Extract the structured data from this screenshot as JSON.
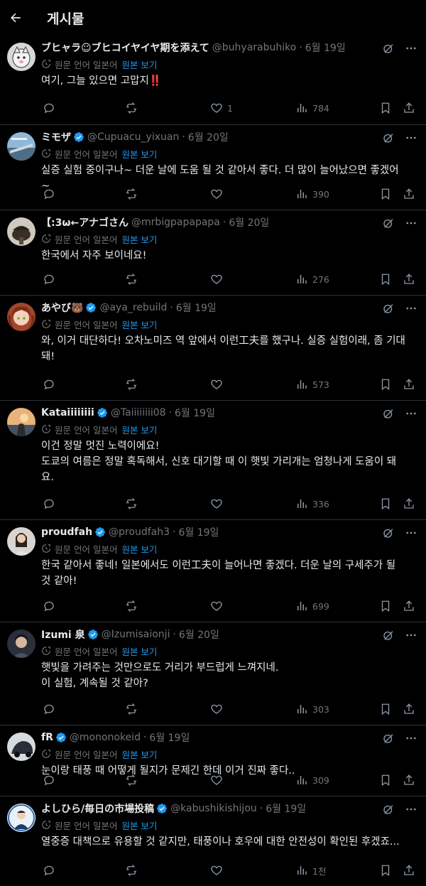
{
  "header": {
    "title": "게시물"
  },
  "translate": {
    "label": "원문 언어 일본어",
    "show": "원본 보기"
  },
  "posts": [
    {
      "name": "ブヒャラ☺ブヒコイヤイヤ期を添えて",
      "handle": "@buhyarabuhiko",
      "date": "6월 19일",
      "verified": false,
      "text": [
        "여기, 그늘 있으면 고맙지‼️"
      ],
      "likes": "1",
      "views": "784"
    },
    {
      "name": "ミモザ",
      "handle": "@Cupuacu_yixuan",
      "date": "6월 20일",
      "verified": true,
      "text": [
        "실증 실험 중이구나~ 더운 날에 도움 될 것 같아서 좋다. 더 많이 늘어났으면 좋겠어",
        "~"
      ],
      "likes": "",
      "views": "390"
    },
    {
      "name": "【:3ω←アナゴさん",
      "handle": "@mrbigpapapapa",
      "date": "6월 20일",
      "verified": false,
      "text": [
        "한국에서 자주 보이네요!"
      ],
      "likes": "",
      "views": "276"
    },
    {
      "name": "あやび🐻",
      "handle": "@aya_rebuild",
      "date": "6월 19일",
      "verified": true,
      "text": [
        "와, 이거 대단하다! 오차노미즈 역 앞에서 이런工夫를 했구나. 실증 실험이래, 좀 기대",
        "돼!"
      ],
      "likes": "",
      "views": "573"
    },
    {
      "name": "Kataiiiiiiii",
      "handle": "@Taiiiiiiii08",
      "date": "6월 19일",
      "verified": true,
      "text": [
        "이건 정말 멋진 노력이에요!",
        "도쿄의 여름은 정말 혹독해서, 신호 대기할 때 이 햇빛 가리개는 엄청나게 도움이 돼",
        "요."
      ],
      "likes": "",
      "views": "336"
    },
    {
      "name": "proudfah",
      "handle": "@proudfah3",
      "date": "6월 19일",
      "verified": true,
      "text": [
        "한국 같아서 좋네! 일본에서도 이런工夫이 늘어나면 좋겠다. 더운 날의 구세주가 될",
        "것 같아!"
      ],
      "likes": "",
      "views": "699"
    },
    {
      "name": "Izumi 泉",
      "handle": "@Izumisaionji",
      "date": "6월 20일",
      "verified": true,
      "text": [
        "햇빛을 가려주는 것만으로도 거리가 부드럽게 느껴지네.",
        "이 실험, 계속될 것 같아?"
      ],
      "likes": "",
      "views": "303"
    },
    {
      "name": "fR",
      "handle": "@mononokeid",
      "date": "6월 19일",
      "verified": true,
      "text": [
        "눈이랑 태풍 때 어떻게 될지가 문제긴 한데 이거 진짜 좋다.."
      ],
      "likes": "",
      "views": "309"
    },
    {
      "name": "よしひら/毎日の市場投稿",
      "handle": "@kabushikishijou",
      "date": "6월 19일",
      "verified": true,
      "text": [
        "열중증 대책으로 유용할 것 같지만, 태풍이나 호우에 대한 안전성이 확인된 후겠죠..."
      ],
      "likes": "",
      "views": "1천"
    }
  ]
}
